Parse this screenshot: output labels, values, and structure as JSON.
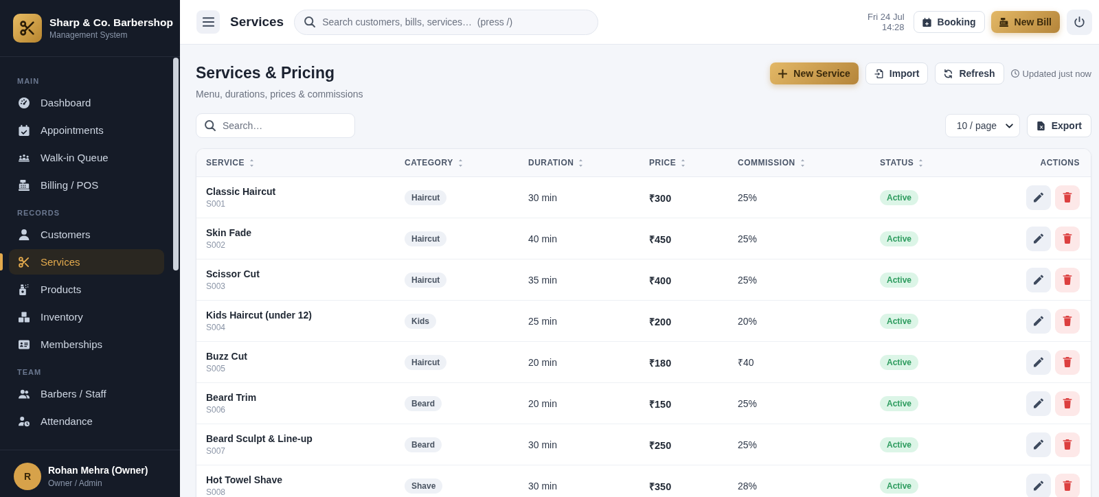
{
  "sidebar": {
    "brand": {
      "name": "Sharp & Co. Barbershop",
      "subtitle": "Management System"
    },
    "sections": [
      {
        "title": "MAIN",
        "items": [
          {
            "label": "Dashboard",
            "selected": false
          },
          {
            "label": "Appointments",
            "selected": false
          },
          {
            "label": "Walk-in Queue",
            "selected": false
          },
          {
            "label": "Billing / POS",
            "selected": false
          }
        ]
      },
      {
        "title": "RECORDS",
        "items": [
          {
            "label": "Customers",
            "selected": false
          },
          {
            "label": "Services",
            "selected": true
          },
          {
            "label": "Products",
            "selected": false
          },
          {
            "label": "Inventory",
            "selected": false
          },
          {
            "label": "Memberships",
            "selected": false
          }
        ]
      },
      {
        "title": "TEAM",
        "items": [
          {
            "label": "Barbers / Staff",
            "selected": false
          },
          {
            "label": "Attendance",
            "selected": false
          }
        ]
      }
    ],
    "user": {
      "initial": "R",
      "name": "Rohan Mehra (Owner)",
      "role": "Owner / Admin"
    }
  },
  "topbar": {
    "title": "Services",
    "search": {
      "placeholder": "Search customers, bills, services…  (press /)"
    },
    "date": "Fri 24 Jul",
    "time": "14:28",
    "buttons": [
      {
        "label": "Booking",
        "kind": "outline"
      },
      {
        "label": "New Bill",
        "kind": "primary"
      }
    ]
  },
  "page": {
    "title": "Services & Pricing",
    "subtitle": "Menu, durations, prices & commissions",
    "actions": [
      {
        "label": "New Service",
        "kind": "primary"
      },
      {
        "label": "Import",
        "kind": "outline"
      },
      {
        "label": "Refresh",
        "kind": "outline"
      }
    ],
    "updated": "Updated just now"
  },
  "toolbar": {
    "search": {
      "placeholder": "Search…"
    },
    "page_size": "10 / page",
    "export": "Export"
  },
  "table": {
    "columns": [
      {
        "label": "SERVICE",
        "sortable": true
      },
      {
        "label": "CATEGORY",
        "sortable": true
      },
      {
        "label": "DURATION",
        "sortable": true
      },
      {
        "label": "PRICE",
        "sortable": true
      },
      {
        "label": "COMMISSION",
        "sortable": true
      },
      {
        "label": "STATUS",
        "sortable": true
      },
      {
        "label": "ACTIONS",
        "sortable": false
      }
    ],
    "rows": [
      {
        "name": "Classic Haircut",
        "code": "S001",
        "category": "Haircut",
        "duration": "30 min",
        "price": "₹300",
        "commission": "25%",
        "status": "Active",
        "active": true
      },
      {
        "name": "Skin Fade",
        "code": "S002",
        "category": "Haircut",
        "duration": "40 min",
        "price": "₹450",
        "commission": "25%",
        "status": "Active",
        "active": true
      },
      {
        "name": "Scissor Cut",
        "code": "S003",
        "category": "Haircut",
        "duration": "35 min",
        "price": "₹400",
        "commission": "25%",
        "status": "Active",
        "active": true
      },
      {
        "name": "Kids Haircut (under 12)",
        "code": "S004",
        "category": "Kids",
        "duration": "25 min",
        "price": "₹200",
        "commission": "20%",
        "status": "Active",
        "active": true
      },
      {
        "name": "Buzz Cut",
        "code": "S005",
        "category": "Haircut",
        "duration": "20 min",
        "price": "₹180",
        "commission": "₹40",
        "status": "Active",
        "active": true
      },
      {
        "name": "Beard Trim",
        "code": "S006",
        "category": "Beard",
        "duration": "20 min",
        "price": "₹150",
        "commission": "25%",
        "status": "Active",
        "active": true
      },
      {
        "name": "Beard Sculpt & Line-up",
        "code": "S007",
        "category": "Beard",
        "duration": "30 min",
        "price": "₹250",
        "commission": "25%",
        "status": "Active",
        "active": true
      },
      {
        "name": "Hot Towel Shave",
        "code": "S008",
        "category": "Shave",
        "duration": "30 min",
        "price": "₹350",
        "commission": "28%",
        "status": "Active",
        "active": true
      }
    ]
  }
}
